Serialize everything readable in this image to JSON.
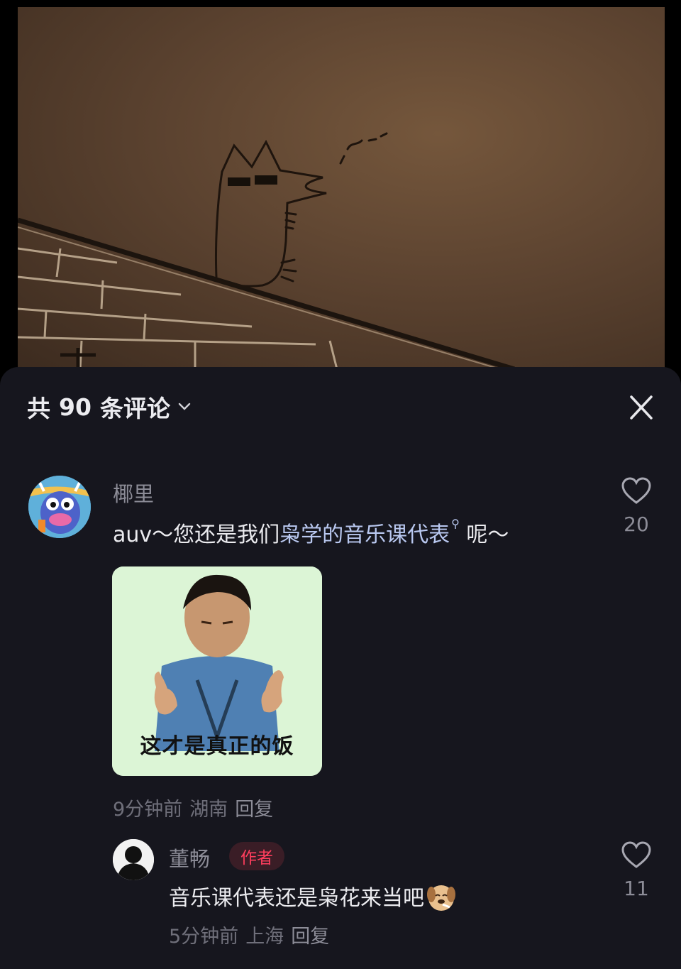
{
  "video": {
    "scene": "hand-drawn cat with sunglasses on a rooftop"
  },
  "comments_panel": {
    "header": {
      "prefix": "共",
      "count": "90",
      "suffix": "条评论"
    },
    "comments": [
      {
        "username": "椰里",
        "text_before": "auv～您还是我们",
        "highlight": "枭学的音乐课代表",
        "text_after": "呢～",
        "likes": "20",
        "sticker_caption": "这才是真正的饭",
        "time": "9分钟前",
        "location": "湖南",
        "reply_label": "回复"
      }
    ],
    "reply": {
      "username": "董畅",
      "badge": "作者",
      "text": "音乐课代表还是枭花来当吧",
      "likes": "11",
      "time": "5分钟前",
      "location": "上海",
      "reply_label": "回复"
    }
  },
  "colors": {
    "panel_bg": "#16161e",
    "highlight": "#b9c8f0",
    "author_badge": "#ff3e5d"
  }
}
